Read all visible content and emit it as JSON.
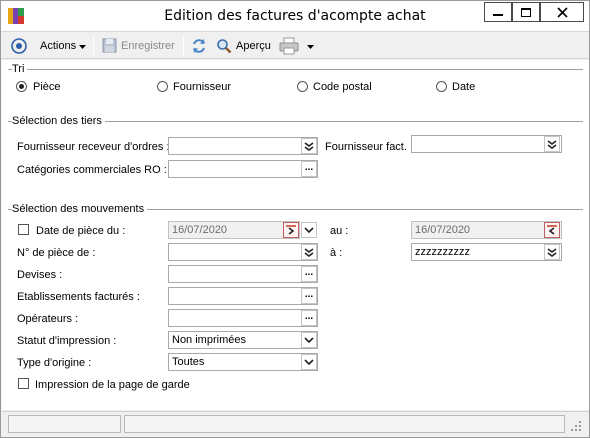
{
  "window": {
    "title": "Edition des factures d'acompte achat"
  },
  "toolbar": {
    "actions_label": "Actions",
    "save_label": "Enregistrer",
    "preview_label": "Aperçu"
  },
  "sort": {
    "title": "Tri",
    "options": [
      "Pièce",
      "Fournisseur",
      "Code postal",
      "Date"
    ],
    "selected": "Pièce"
  },
  "tiers": {
    "title": "Sélection des tiers",
    "receveur_label": "Fournisseur receveur d'ordres :",
    "receveur_value": "",
    "fact_label": "Fournisseur fact. :",
    "fact_value": "",
    "categories_label": "Catégories commerciales RO :",
    "categories_value": ""
  },
  "mouvements": {
    "title": "Sélection des mouvements",
    "date_label": "Date de pièce du :",
    "date_from": "16/07/2020",
    "date_to_label": "au :",
    "date_to": "16/07/2020",
    "piece_label": "N° de pièce de :",
    "piece_from": "",
    "piece_to_label": "à :",
    "piece_to": "zzzzzzzzzz",
    "devises_label": "Devises :",
    "devises_value": "",
    "etab_label": "Etablissements facturés :",
    "etab_value": "",
    "operateurs_label": "Opérateurs :",
    "operateurs_value": "",
    "statut_label": "Statut d'impression :",
    "statut_value": "Non imprimées",
    "origine_label": "Type d'origine :",
    "origine_value": "Toutes",
    "garde_label": "Impression de la page de garde"
  }
}
